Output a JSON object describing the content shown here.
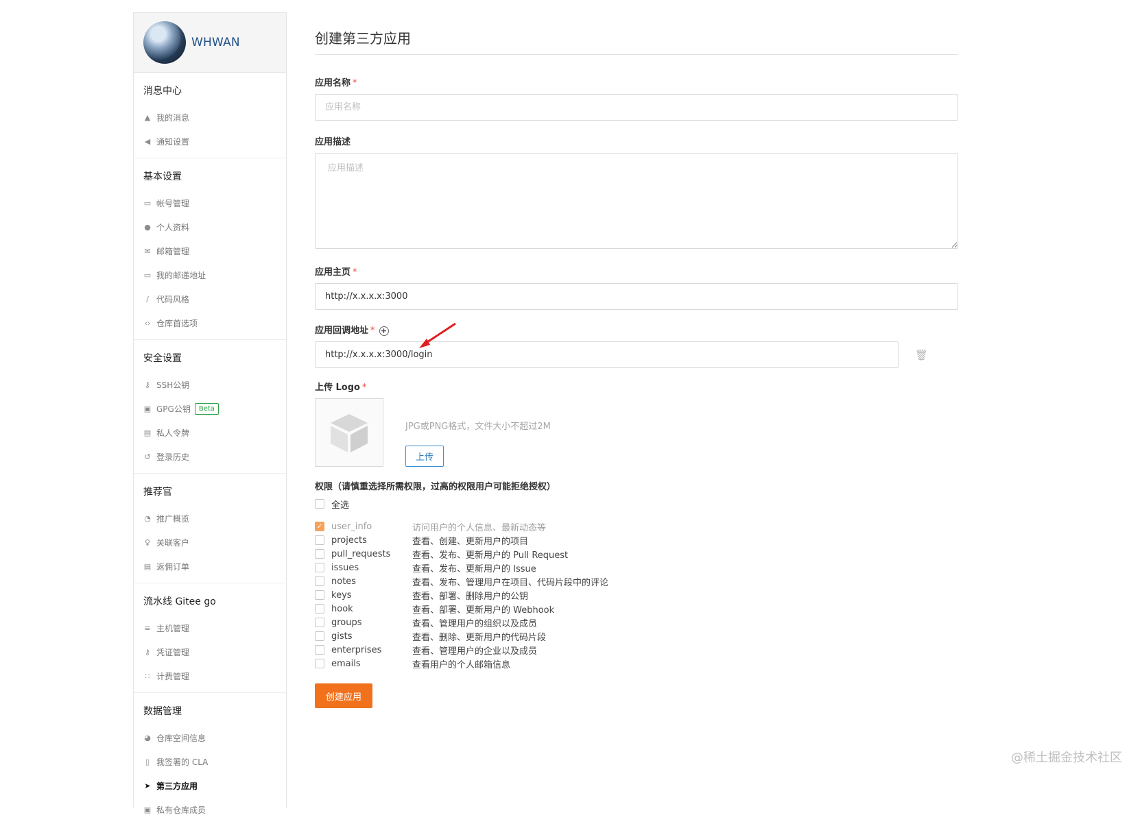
{
  "user": {
    "name": "WHWAN"
  },
  "sidebar": {
    "groups": [
      {
        "title": "消息中心",
        "items": [
          {
            "label": "我的消息",
            "icon": "bell-icon"
          },
          {
            "label": "通知设置",
            "icon": "volume-icon"
          }
        ]
      },
      {
        "title": "基本设置",
        "items": [
          {
            "label": "帐号管理",
            "icon": "id-card-icon"
          },
          {
            "label": "个人资料",
            "icon": "user-icon"
          },
          {
            "label": "邮箱管理",
            "icon": "envelope-icon"
          },
          {
            "label": "我的邮递地址",
            "icon": "address-card-icon"
          },
          {
            "label": "代码风格",
            "icon": "brush-icon"
          },
          {
            "label": "仓库首选项",
            "icon": "code-icon"
          }
        ]
      },
      {
        "title": "安全设置",
        "items": [
          {
            "label": "SSH公钥",
            "icon": "key-icon"
          },
          {
            "label": "GPG公钥",
            "icon": "lock-icon",
            "badge": "Beta"
          },
          {
            "label": "私人令牌",
            "icon": "token-icon"
          },
          {
            "label": "登录历史",
            "icon": "history-icon"
          }
        ]
      },
      {
        "title": "推荐官",
        "items": [
          {
            "label": "推广概览",
            "icon": "dashboard-icon"
          },
          {
            "label": "关联客户",
            "icon": "user-link-icon"
          },
          {
            "label": "返佣订单",
            "icon": "order-icon"
          }
        ]
      },
      {
        "title": "流水线 Gitee go",
        "items": [
          {
            "label": "主机管理",
            "icon": "server-icon"
          },
          {
            "label": "凭证管理",
            "icon": "credential-icon"
          },
          {
            "label": "计费管理",
            "icon": "billing-icon"
          }
        ]
      },
      {
        "title": "数据管理",
        "items": [
          {
            "label": "仓库空间信息",
            "icon": "pie-chart-icon"
          },
          {
            "label": "我签署的 CLA",
            "icon": "document-icon"
          },
          {
            "label": "第三方应用",
            "icon": "rocket-icon",
            "active": true
          },
          {
            "label": "私有仓库成员",
            "icon": "members-icon"
          }
        ]
      }
    ]
  },
  "form": {
    "title": "创建第三方应用",
    "app_name": {
      "label": "应用名称",
      "placeholder": "应用名称",
      "value": ""
    },
    "app_desc": {
      "label": "应用描述",
      "placeholder": "应用描述"
    },
    "homepage": {
      "label": "应用主页",
      "value": "http://x.x.x.x:3000"
    },
    "callback": {
      "label": "应用回调地址",
      "value": "http://x.x.x.x:3000/login"
    },
    "logo": {
      "label": "上传 Logo",
      "hint": "JPG或PNG格式，文件大小不超过2M",
      "button": "上传"
    },
    "permissions": {
      "label": "权限（请慎重选择所需权限，过高的权限用户可能拒绝授权）",
      "select_all": "全选",
      "scopes": [
        {
          "name": "user_info",
          "desc": "访问用户的个人信息、最新动态等",
          "checked": true,
          "disabled": true
        },
        {
          "name": "projects",
          "desc": "查看、创建、更新用户的项目"
        },
        {
          "name": "pull_requests",
          "desc": "查看、发布、更新用户的 Pull Request"
        },
        {
          "name": "issues",
          "desc": "查看、发布、更新用户的 Issue"
        },
        {
          "name": "notes",
          "desc": "查看、发布、管理用户在项目、代码片段中的评论"
        },
        {
          "name": "keys",
          "desc": "查看、部署、删除用户的公钥"
        },
        {
          "name": "hook",
          "desc": "查看、部署、更新用户的 Webhook"
        },
        {
          "name": "groups",
          "desc": "查看、管理用户的组织以及成员"
        },
        {
          "name": "gists",
          "desc": "查看、删除、更新用户的代码片段"
        },
        {
          "name": "enterprises",
          "desc": "查看、管理用户的企业以及成员"
        },
        {
          "name": "emails",
          "desc": "查看用户的个人邮箱信息"
        }
      ]
    },
    "submit": "创建应用"
  },
  "colors": {
    "accent": "#f2711c",
    "link": "#225288",
    "required": "#e74c3c",
    "annotation_arrow": "#e01e1e"
  },
  "watermark": "@稀土掘金技术社区"
}
